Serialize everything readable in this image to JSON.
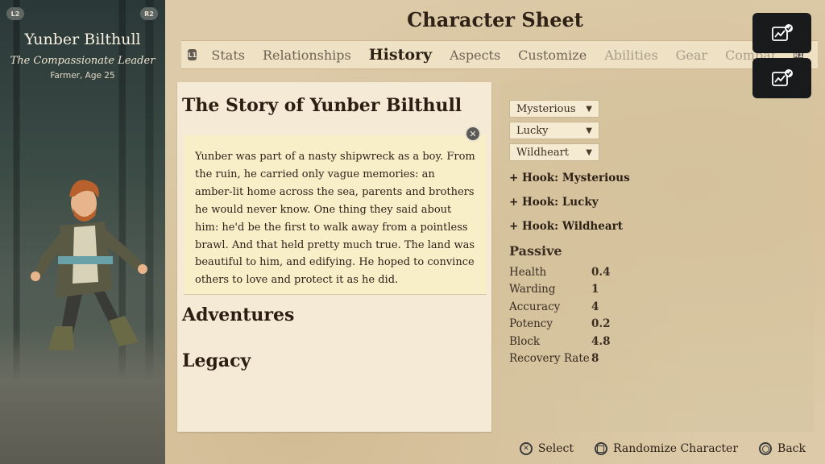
{
  "character": {
    "left_shoulder": "L2",
    "right_shoulder": "R2",
    "name": "Yunber Bilthull",
    "title": "The Compassionate Leader",
    "subtitle": "Farmer, Age 25"
  },
  "header": {
    "title": "Character Sheet"
  },
  "tabs": {
    "left_button": "L1",
    "right_button": "R1",
    "items": [
      {
        "label": "Stats",
        "state": "normal"
      },
      {
        "label": "Relationships",
        "state": "normal"
      },
      {
        "label": "History",
        "state": "active"
      },
      {
        "label": "Aspects",
        "state": "normal"
      },
      {
        "label": "Customize",
        "state": "normal"
      },
      {
        "label": "Abilities",
        "state": "disabled"
      },
      {
        "label": "Gear",
        "state": "disabled"
      },
      {
        "label": "Combat",
        "state": "disabled"
      }
    ]
  },
  "story": {
    "title": "The Story of Yunber Bilthull",
    "text": "Yunber was part of a nasty shipwreck as a boy. From the ruin, he carried only vague memories: an amber-lit home across the sea, parents and brothers he would never know. One thing they said about him: he'd be the first to walk away from a pointless brawl. And that held pretty much true. The land was beautiful to him, and edifying. He hoped to convince others to love and protect it as he did.",
    "close_icon": "cross-button-icon",
    "sections": [
      "Adventures",
      "Legacy"
    ]
  },
  "traits": {
    "dropdowns": [
      "Mysterious",
      "Lucky",
      "Wildheart"
    ],
    "hooks": [
      "+ Hook: Mysterious",
      "+ Hook: Lucky",
      "+ Hook: Wildheart"
    ]
  },
  "passive": {
    "title": "Passive",
    "stats": [
      {
        "label": "Health",
        "value": "0.4"
      },
      {
        "label": "Warding",
        "value": "1"
      },
      {
        "label": "Accuracy",
        "value": "4"
      },
      {
        "label": "Potency",
        "value": "0.2"
      },
      {
        "label": "Block",
        "value": "4.8"
      },
      {
        "label": "Recovery Rate",
        "value": "8"
      }
    ]
  },
  "floating_buttons": [
    "chart-check-icon",
    "chart-check-icon"
  ],
  "footer": {
    "select": "Select",
    "randomize": "Randomize Character",
    "back": "Back"
  },
  "colors": {
    "parchment": "#dccaa8",
    "panel": "#f4ead5",
    "story_box": "#f8efc9",
    "text_dark": "#2b1d12",
    "floating_button": "#181a1c"
  }
}
